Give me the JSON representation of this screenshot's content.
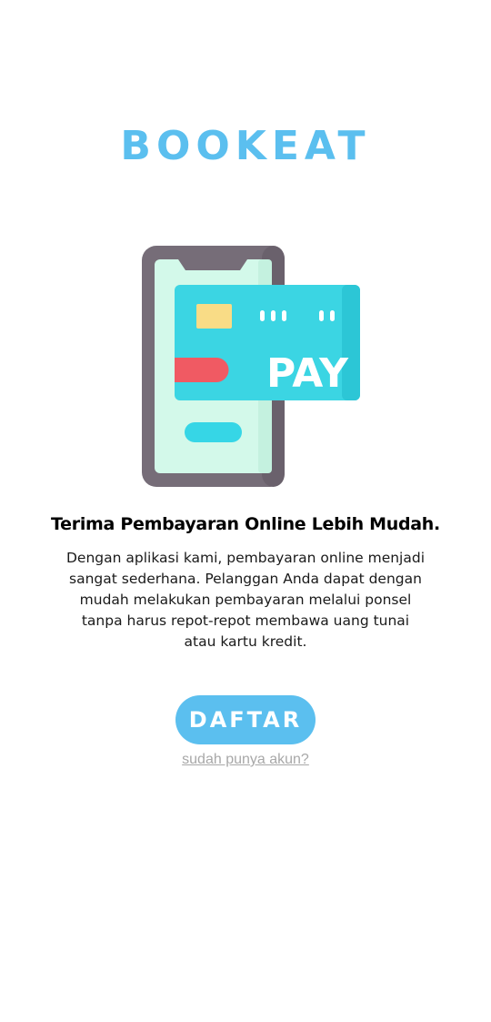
{
  "app": {
    "brand_name": "BOOKEAT"
  },
  "illustration": {
    "card_label": "PAY",
    "icon_name": "phone-payment-icon",
    "colors": {
      "phone_frame": "#766d78",
      "phone_screen": "#d3f9ea",
      "card": "#3bd5e3",
      "card_dark": "#2cc6d6",
      "chip": "#f9dc86",
      "stripe": "#f05a63",
      "screen_button": "#36d6e6"
    }
  },
  "onboarding": {
    "headline": "Terima Pembayaran Online Lebih Mudah.",
    "description": "Dengan aplikasi kami, pembayaran online menjadi sangat sederhana. Pelanggan Anda dapat dengan mudah melakukan pembayaran melalui ponsel tanpa harus repot-repot membawa uang tunai atau kartu kredit."
  },
  "actions": {
    "register_label": "DAFTAR",
    "login_link": "sudah punya akun?"
  },
  "theme": {
    "accent": "#5bbfef",
    "link_color": "#a8a8a8"
  }
}
